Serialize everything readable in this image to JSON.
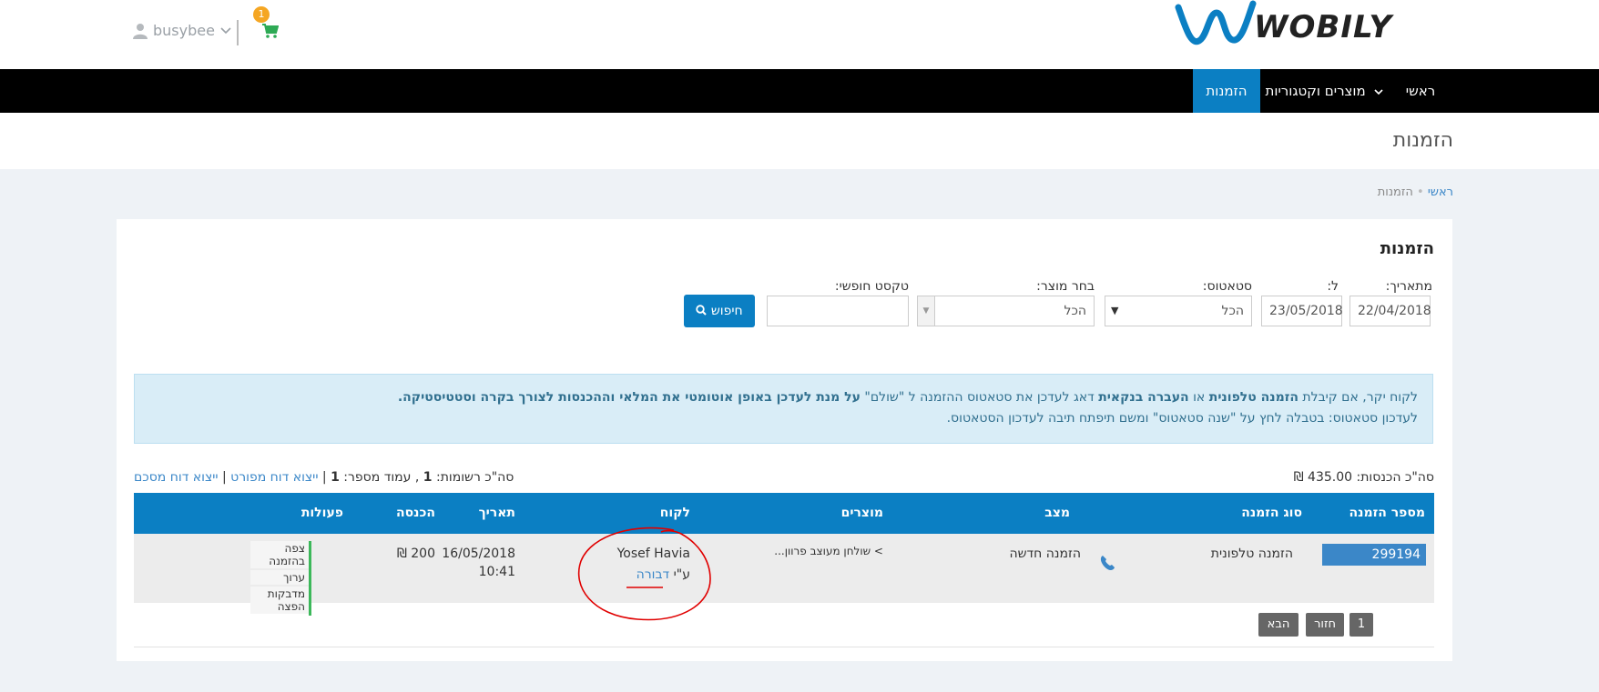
{
  "header": {
    "username": "busybee",
    "cart_count": "1",
    "logo_text": "WOBILY"
  },
  "nav": {
    "items": [
      {
        "label": "ראשי"
      },
      {
        "label": "מוצרים וקטגוריות"
      },
      {
        "label": "הזמנות"
      }
    ]
  },
  "page": {
    "title": "הזמנות",
    "breadcrumb": {
      "home": "ראשי",
      "current": "הזמנות"
    }
  },
  "card": {
    "title": "הזמנות",
    "filters": {
      "from_label": "מתאריך:",
      "from_value": "22/04/2018",
      "to_label": "ל:",
      "to_value": "23/05/2018",
      "status_label": "סטאטוס:",
      "status_value": "הכל",
      "product_label": "בחר מוצר:",
      "product_value": "הכל",
      "text_label": "טקסט חופשי:",
      "text_value": "",
      "search_label": "חיפוש"
    },
    "alert": {
      "line1_a": "לקוח יקר, אם קיבלת ",
      "line1_b": "הזמנה טלפונית",
      "line1_c": " או ",
      "line1_d": "העברה בנקאית",
      "line1_e": " דאג לעדכן את סטאטוס ההזמנה ל \"שולם\" ",
      "line1_f": "על מנת לעדכן באופן אוטומטי את המלאי וההכנסות לצורך בקרה וסטטיסטיקה.",
      "line2": "לעדכון סטאטוס: בטבלה לחץ על \"שנה סטאטוס\" ומשם תיפתח תיבה לעדכון הסטאטוס."
    },
    "summary": {
      "income_label": "סה\"כ הכנסות:",
      "income_value": "435.00 ₪",
      "records_label": "סה\"כ רשומות:",
      "records_value": "1",
      "page_label": ", עמוד מספר:",
      "page_value": "1",
      "export_detailed": "ייצוא דוח מפורט",
      "export_summary": "ייצוא דוח מסכם"
    },
    "table": {
      "headers": {
        "order_no": "מספר הזמנה",
        "order_type": "סוג הזמנה",
        "status": "מצב",
        "products": "מוצרים",
        "customer": "לקוח",
        "date": "תאריך",
        "income": "הכנסה",
        "actions": "פעולות"
      },
      "rows": [
        {
          "order_no": "299194",
          "order_type": "הזמנה טלפונית",
          "status": "הזמנה חדשה",
          "products": "> שולחן מעוצב פרוון...",
          "customer_name": "Yosef Havia",
          "by_prefix": "ע\"י",
          "by_name": "דבורה",
          "date": "16/05/2018",
          "time": "10:41",
          "income": "200 ₪",
          "actions": [
            "צפה בהזמנה",
            "ערוך",
            "מדבקות הפצה"
          ]
        }
      ]
    },
    "pager": {
      "back": "חזור",
      "page": "1",
      "next": "הבא"
    }
  },
  "colors": {
    "primary": "#0b7fc3",
    "annotation": "#e00000"
  }
}
